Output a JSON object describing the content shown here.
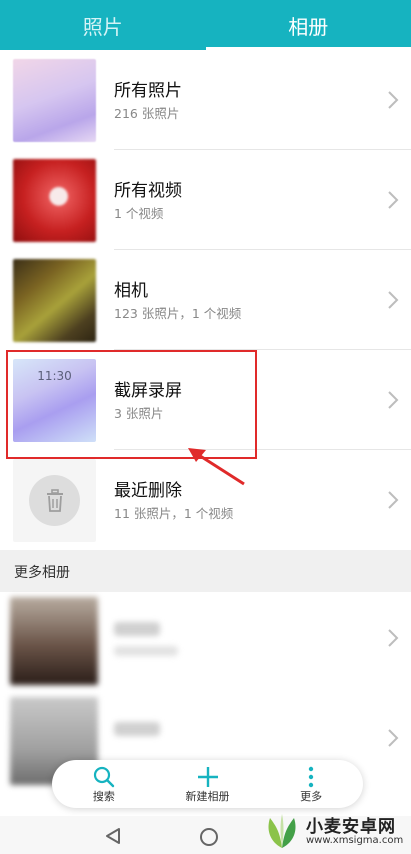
{
  "tabs": [
    {
      "label": "照片",
      "active": false
    },
    {
      "label": "相册",
      "active": true
    }
  ],
  "albums": [
    {
      "title": "所有照片",
      "subtitle": "216 张照片"
    },
    {
      "title": "所有视频",
      "subtitle": "1 个视频"
    },
    {
      "title": "相机",
      "subtitle": "123 张照片，1 个视频"
    },
    {
      "title": "截屏录屏",
      "subtitle": "3 张照片",
      "thumb_time": "11:30"
    },
    {
      "title": "最近删除",
      "subtitle": "11 张照片，1 个视频"
    }
  ],
  "section_more": "更多相册",
  "actions": [
    {
      "label": "搜索",
      "icon": "search-icon"
    },
    {
      "label": "新建相册",
      "icon": "plus-icon"
    },
    {
      "label": "更多",
      "icon": "more-vertical-icon"
    }
  ],
  "navbar": {
    "back_icon": "back-triangle-icon",
    "home_icon": "home-circle-icon"
  },
  "watermark": {
    "title": "小麦安卓网",
    "url": "www.xmsigma.com"
  },
  "colors": {
    "accent": "#16b3c0",
    "highlight": "#e02a2a"
  }
}
